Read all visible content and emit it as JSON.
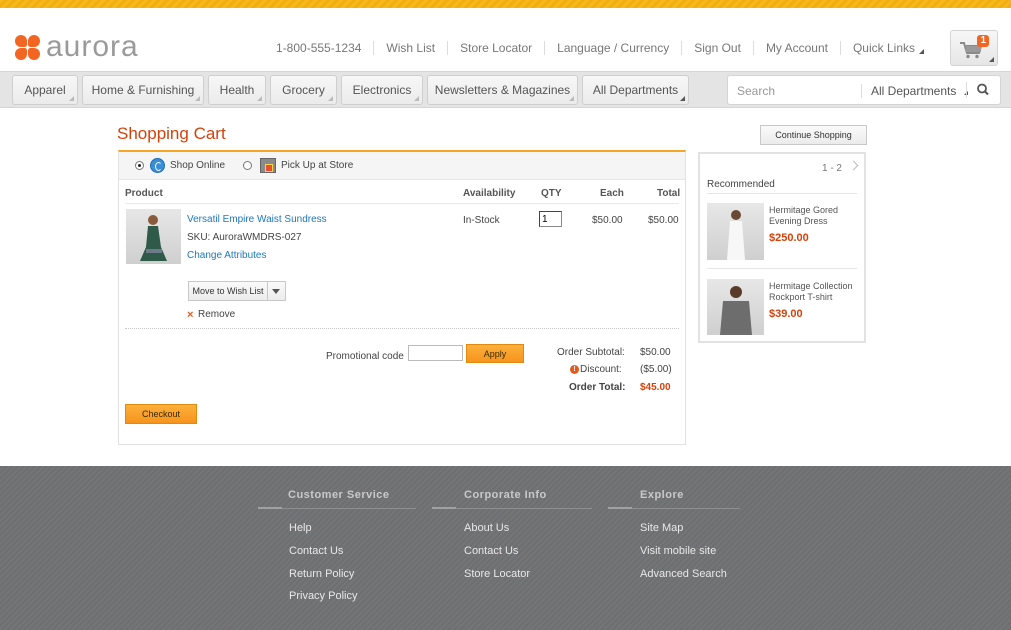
{
  "brand": {
    "name": "aurora",
    "logo_color": "#f26522",
    "accent": "#f5a623",
    "title_color": "#d4420c"
  },
  "header": {
    "links": [
      "1-800-555-1234",
      "Wish List",
      "Store Locator",
      "Language / Currency",
      "Sign Out",
      "My Account",
      "Quick Links"
    ],
    "cart_count": "1"
  },
  "nav": {
    "departments": [
      "Apparel",
      "Home & Furnishing",
      "Health",
      "Grocery",
      "Electronics",
      "Newsletters & Magazines",
      "All Departments"
    ],
    "search": {
      "placeholder": "Search",
      "department": "All Departments"
    }
  },
  "page": {
    "title": "Shopping Cart",
    "continue_label": "Continue Shopping"
  },
  "shipping": {
    "options": [
      "Shop Online",
      "Pick Up at Store"
    ],
    "selected": "Shop Online"
  },
  "cart": {
    "columns": {
      "product": "Product",
      "availability": "Availability",
      "qty": "QTY",
      "each": "Each",
      "total": "Total"
    },
    "items": [
      {
        "name": "Versatil Empire Waist Sundress",
        "sku": "SKU: AuroraWMDRS-027",
        "change_label": "Change Attributes",
        "availability": "In-Stock",
        "qty": "1",
        "each": "$50.00",
        "total": "$50.00",
        "wish_label": "Move to Wish List",
        "remove_label": "Remove"
      }
    ],
    "promo": {
      "label": "Promotional code",
      "value": "",
      "apply_label": "Apply"
    },
    "summary": {
      "subtotal_label": "Order Subtotal:",
      "subtotal": "$50.00",
      "discount_label": "Discount:",
      "discount": "($5.00)",
      "total_label": "Order Total:",
      "total": "$45.00"
    },
    "checkout_label": "Checkout"
  },
  "recommended": {
    "heading": "Recommended",
    "pager": "1 - 2",
    "items": [
      {
        "name": "Hermitage Gored Evening Dress",
        "price": "$250.00"
      },
      {
        "name": "Hermitage Collection Rockport T-shirt",
        "price": "$39.00"
      }
    ]
  },
  "footer": {
    "columns": [
      {
        "heading": "Customer Service",
        "links": [
          "Help",
          "Contact Us",
          "Return Policy",
          "Privacy Policy"
        ]
      },
      {
        "heading": "Corporate Info",
        "links": [
          "About Us",
          "Contact Us",
          "Store Locator"
        ]
      },
      {
        "heading": "Explore",
        "links": [
          "Site Map",
          "Visit mobile site",
          "Advanced Search"
        ]
      }
    ]
  }
}
